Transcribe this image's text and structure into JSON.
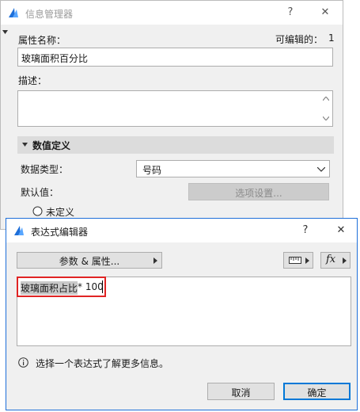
{
  "info_manager": {
    "title": "信息管理器",
    "help_label": "?",
    "close_label": "✕",
    "property_name_label": "属性名称：",
    "editable_label": "可编辑的：",
    "editable_count": "1",
    "property_name_value": "玻璃面积百分比",
    "description_label": "描述：",
    "description_value": "",
    "section_title": "数值定义",
    "data_type_label": "数据类型：",
    "data_type_value": "号码",
    "default_value_label": "默认值：",
    "options_button": "选项设置...",
    "undefined_option": "未定义"
  },
  "expression_editor": {
    "title": "表达式编辑器",
    "help_label": "?",
    "close_label": "✕",
    "params_button": "参数 & 属性...",
    "fx_label": "fx",
    "expression_token": "玻璃面积占比",
    "expression_rest": " * 100",
    "info_text": "选择一个表达式了解更多信息。",
    "cancel_button": "取消",
    "ok_button": "确定"
  }
}
